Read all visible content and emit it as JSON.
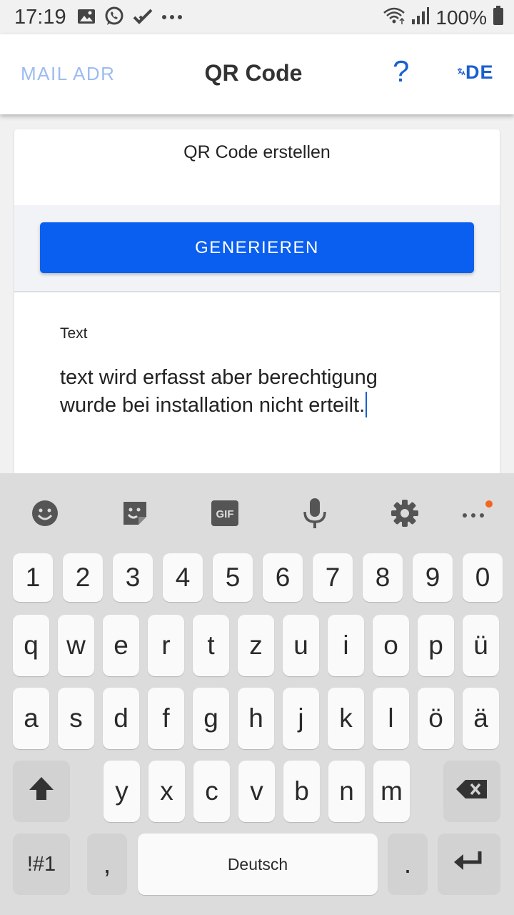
{
  "status_bar": {
    "time": "17:19",
    "battery": "100%",
    "notification_icons": [
      "gallery-icon",
      "whatsapp-icon",
      "check-icon",
      "more-icon"
    ]
  },
  "app_bar": {
    "left_action": "MAIL ADR",
    "title": "QR Code",
    "help": "?",
    "language": "DE"
  },
  "card": {
    "heading": "QR Code erstellen",
    "generate_button": "GENERIEREN",
    "field_label": "Text",
    "field_value_line1": "text wird erfasst aber berechtigung",
    "field_value_line2": "wurde bei installation nicht erteilt."
  },
  "keyboard": {
    "number_row": [
      "1",
      "2",
      "3",
      "4",
      "5",
      "6",
      "7",
      "8",
      "9",
      "0"
    ],
    "row1": [
      "q",
      "w",
      "e",
      "r",
      "t",
      "z",
      "u",
      "i",
      "o",
      "p",
      "ü"
    ],
    "row2": [
      "a",
      "s",
      "d",
      "f",
      "g",
      "h",
      "j",
      "k",
      "l",
      "ö",
      "ä"
    ],
    "row3": [
      "y",
      "x",
      "c",
      "v",
      "b",
      "n",
      "m"
    ],
    "symbols_key": "!#1",
    "comma_key": ",",
    "space_label": "Deutsch",
    "period_key": "."
  },
  "colors": {
    "accent": "#0a5ff0",
    "link_blue": "#1a5fd0",
    "muted_blue": "#9dbcf0",
    "notification_dot": "#f26522"
  }
}
